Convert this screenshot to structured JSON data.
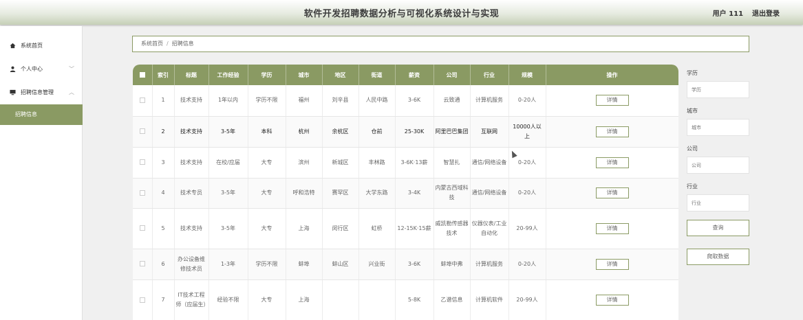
{
  "header": {
    "title": "软件开发招聘数据分析与可视化系统设计与实现",
    "user_label": "用户 111",
    "logout_label": "退出登录"
  },
  "sidebar": {
    "items": [
      {
        "label": "系统首页",
        "icon": "home-icon",
        "chevron": ""
      },
      {
        "label": "个人中心",
        "icon": "user-icon",
        "chevron": "﹀"
      },
      {
        "label": "招聘信息管理",
        "icon": "monitor-icon",
        "chevron": "︿"
      },
      {
        "label": "招聘信息",
        "icon": "",
        "chevron": ""
      }
    ],
    "active_index": 3
  },
  "breadcrumb": {
    "home": "系统首页",
    "separator": "/",
    "current": "招聘信息"
  },
  "table": {
    "headers": [
      "索引",
      "标题",
      "工作经验",
      "学历",
      "城市",
      "地区",
      "街道",
      "薪资",
      "公司",
      "行业",
      "规模",
      "操作"
    ],
    "detail_label": "详情",
    "rows": [
      [
        "1",
        "技术支持",
        "1年以内",
        "学历不限",
        "福州",
        "刘辛县",
        "人民中路",
        "3-6K",
        "云致通",
        "计算机服务",
        "0-20人"
      ],
      [
        "2",
        "技术支持",
        "3-5年",
        "本科",
        "杭州",
        "余杭区",
        "仓前",
        "25-30K",
        "阿里巴巴集团",
        "互联网",
        "10000人以上"
      ],
      [
        "3",
        "技术支持",
        "在校/应届",
        "大专",
        "滨州",
        "新城区",
        "丰林路",
        "3-6K·13薪",
        "智慧扎",
        "通信/网络设备",
        "0-20人"
      ],
      [
        "4",
        "技术专员",
        "3-5年",
        "大专",
        "呼和浩特",
        "赛罕区",
        "大学东路",
        "3-4K",
        "内蒙古西域科技",
        "通信/网络设备",
        "0-20人"
      ],
      [
        "5",
        "技术支持",
        "3-5年",
        "大专",
        "上海",
        "闵行区",
        "虹桥",
        "12-15K·15薪",
        "威凯勒传感器技术",
        "仪器仪表/工业自动化",
        "20-99人"
      ],
      [
        "6",
        "办公设备维修技术员",
        "1-3年",
        "学历不限",
        "蚌埠",
        "蚌山区",
        "兴业街",
        "3-6K",
        "蚌埠中弗",
        "计算机服务",
        "0-20人"
      ],
      [
        "7",
        "IT技术工程师（应届生）",
        "经验不限",
        "大专",
        "上海",
        "",
        "",
        "5-8K",
        "乙谱信息",
        "计算机软件",
        "20-99人"
      ]
    ]
  },
  "filters": {
    "education": {
      "label": "学历",
      "placeholder": "学历"
    },
    "city": {
      "label": "城市",
      "placeholder": "城市"
    },
    "company": {
      "label": "公司",
      "placeholder": "公司"
    },
    "industry": {
      "label": "行业",
      "placeholder": "行业"
    },
    "search_label": "查询",
    "crawl_label": "爬取数据"
  },
  "colors": {
    "accent": "#8a9a63",
    "header_gradient_end": "#c6d0b7"
  }
}
